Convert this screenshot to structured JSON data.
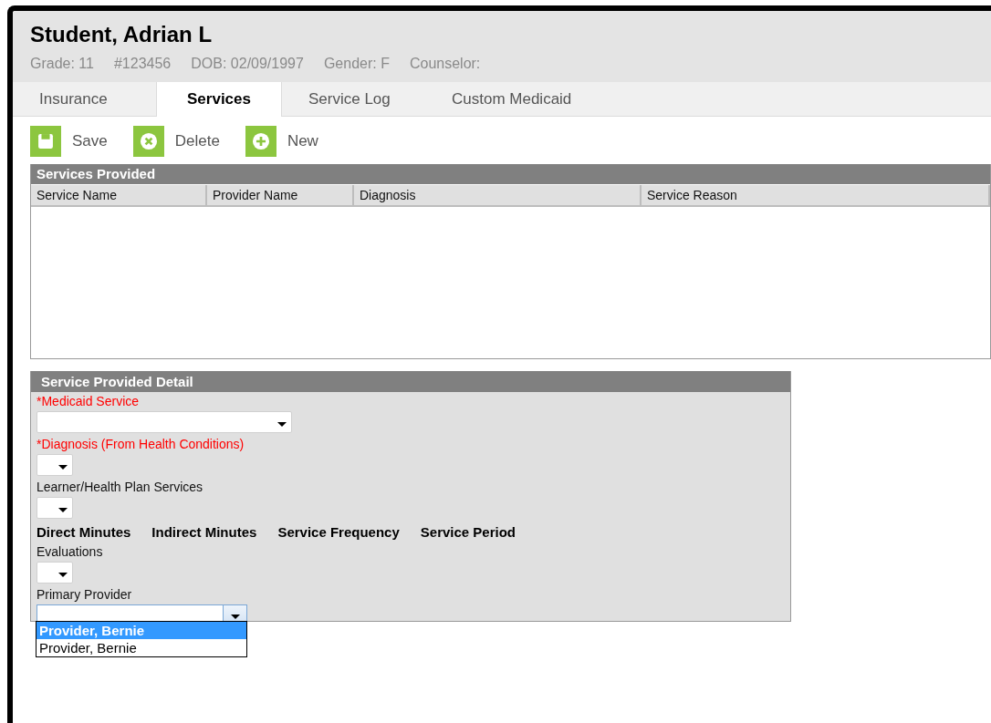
{
  "student": {
    "name": "Student, Adrian L",
    "meta": [
      "Grade: 11",
      "#123456",
      "DOB: 02/09/1997",
      "Gender: F",
      "Counselor:"
    ]
  },
  "tabs": [
    {
      "label": "Insurance",
      "selected": false
    },
    {
      "label": "Services",
      "selected": true
    },
    {
      "label": "Service Log",
      "selected": false
    },
    {
      "label": "Custom Medicaid",
      "selected": false
    }
  ],
  "toolbar": [
    {
      "label": "Save",
      "kind": "save"
    },
    {
      "label": "Delete",
      "kind": "delete"
    },
    {
      "label": "New",
      "kind": "new"
    }
  ],
  "services_provided": {
    "title": "Services Provided",
    "columns": [
      "Service Name",
      "Provider Name",
      "Diagnosis",
      "Service Reason"
    ]
  },
  "detail": {
    "title": "Service Provided Detail",
    "fields": [
      {
        "kind": "select",
        "label": "*Medicaid Service",
        "required": true,
        "wide": true
      },
      {
        "kind": "select",
        "label": "*Diagnosis (From Health Conditions)",
        "required": true,
        "wide": false
      },
      {
        "kind": "select",
        "label": "Learner/Health Plan Services",
        "required": false,
        "wide": false
      },
      {
        "kind": "headings",
        "labels": [
          "Direct Minutes",
          "Indirect Minutes",
          "Service Frequency",
          "Service Period"
        ]
      },
      {
        "kind": "select",
        "label": "Evaluations",
        "required": false,
        "wide": false
      },
      {
        "kind": "combo",
        "label": "Primary Provider",
        "required": false,
        "expanded": true,
        "options": [
          {
            "label": "Provider, Bernie",
            "selected": true
          },
          {
            "label": "Provider, Bernie",
            "selected": false
          }
        ]
      }
    ]
  }
}
